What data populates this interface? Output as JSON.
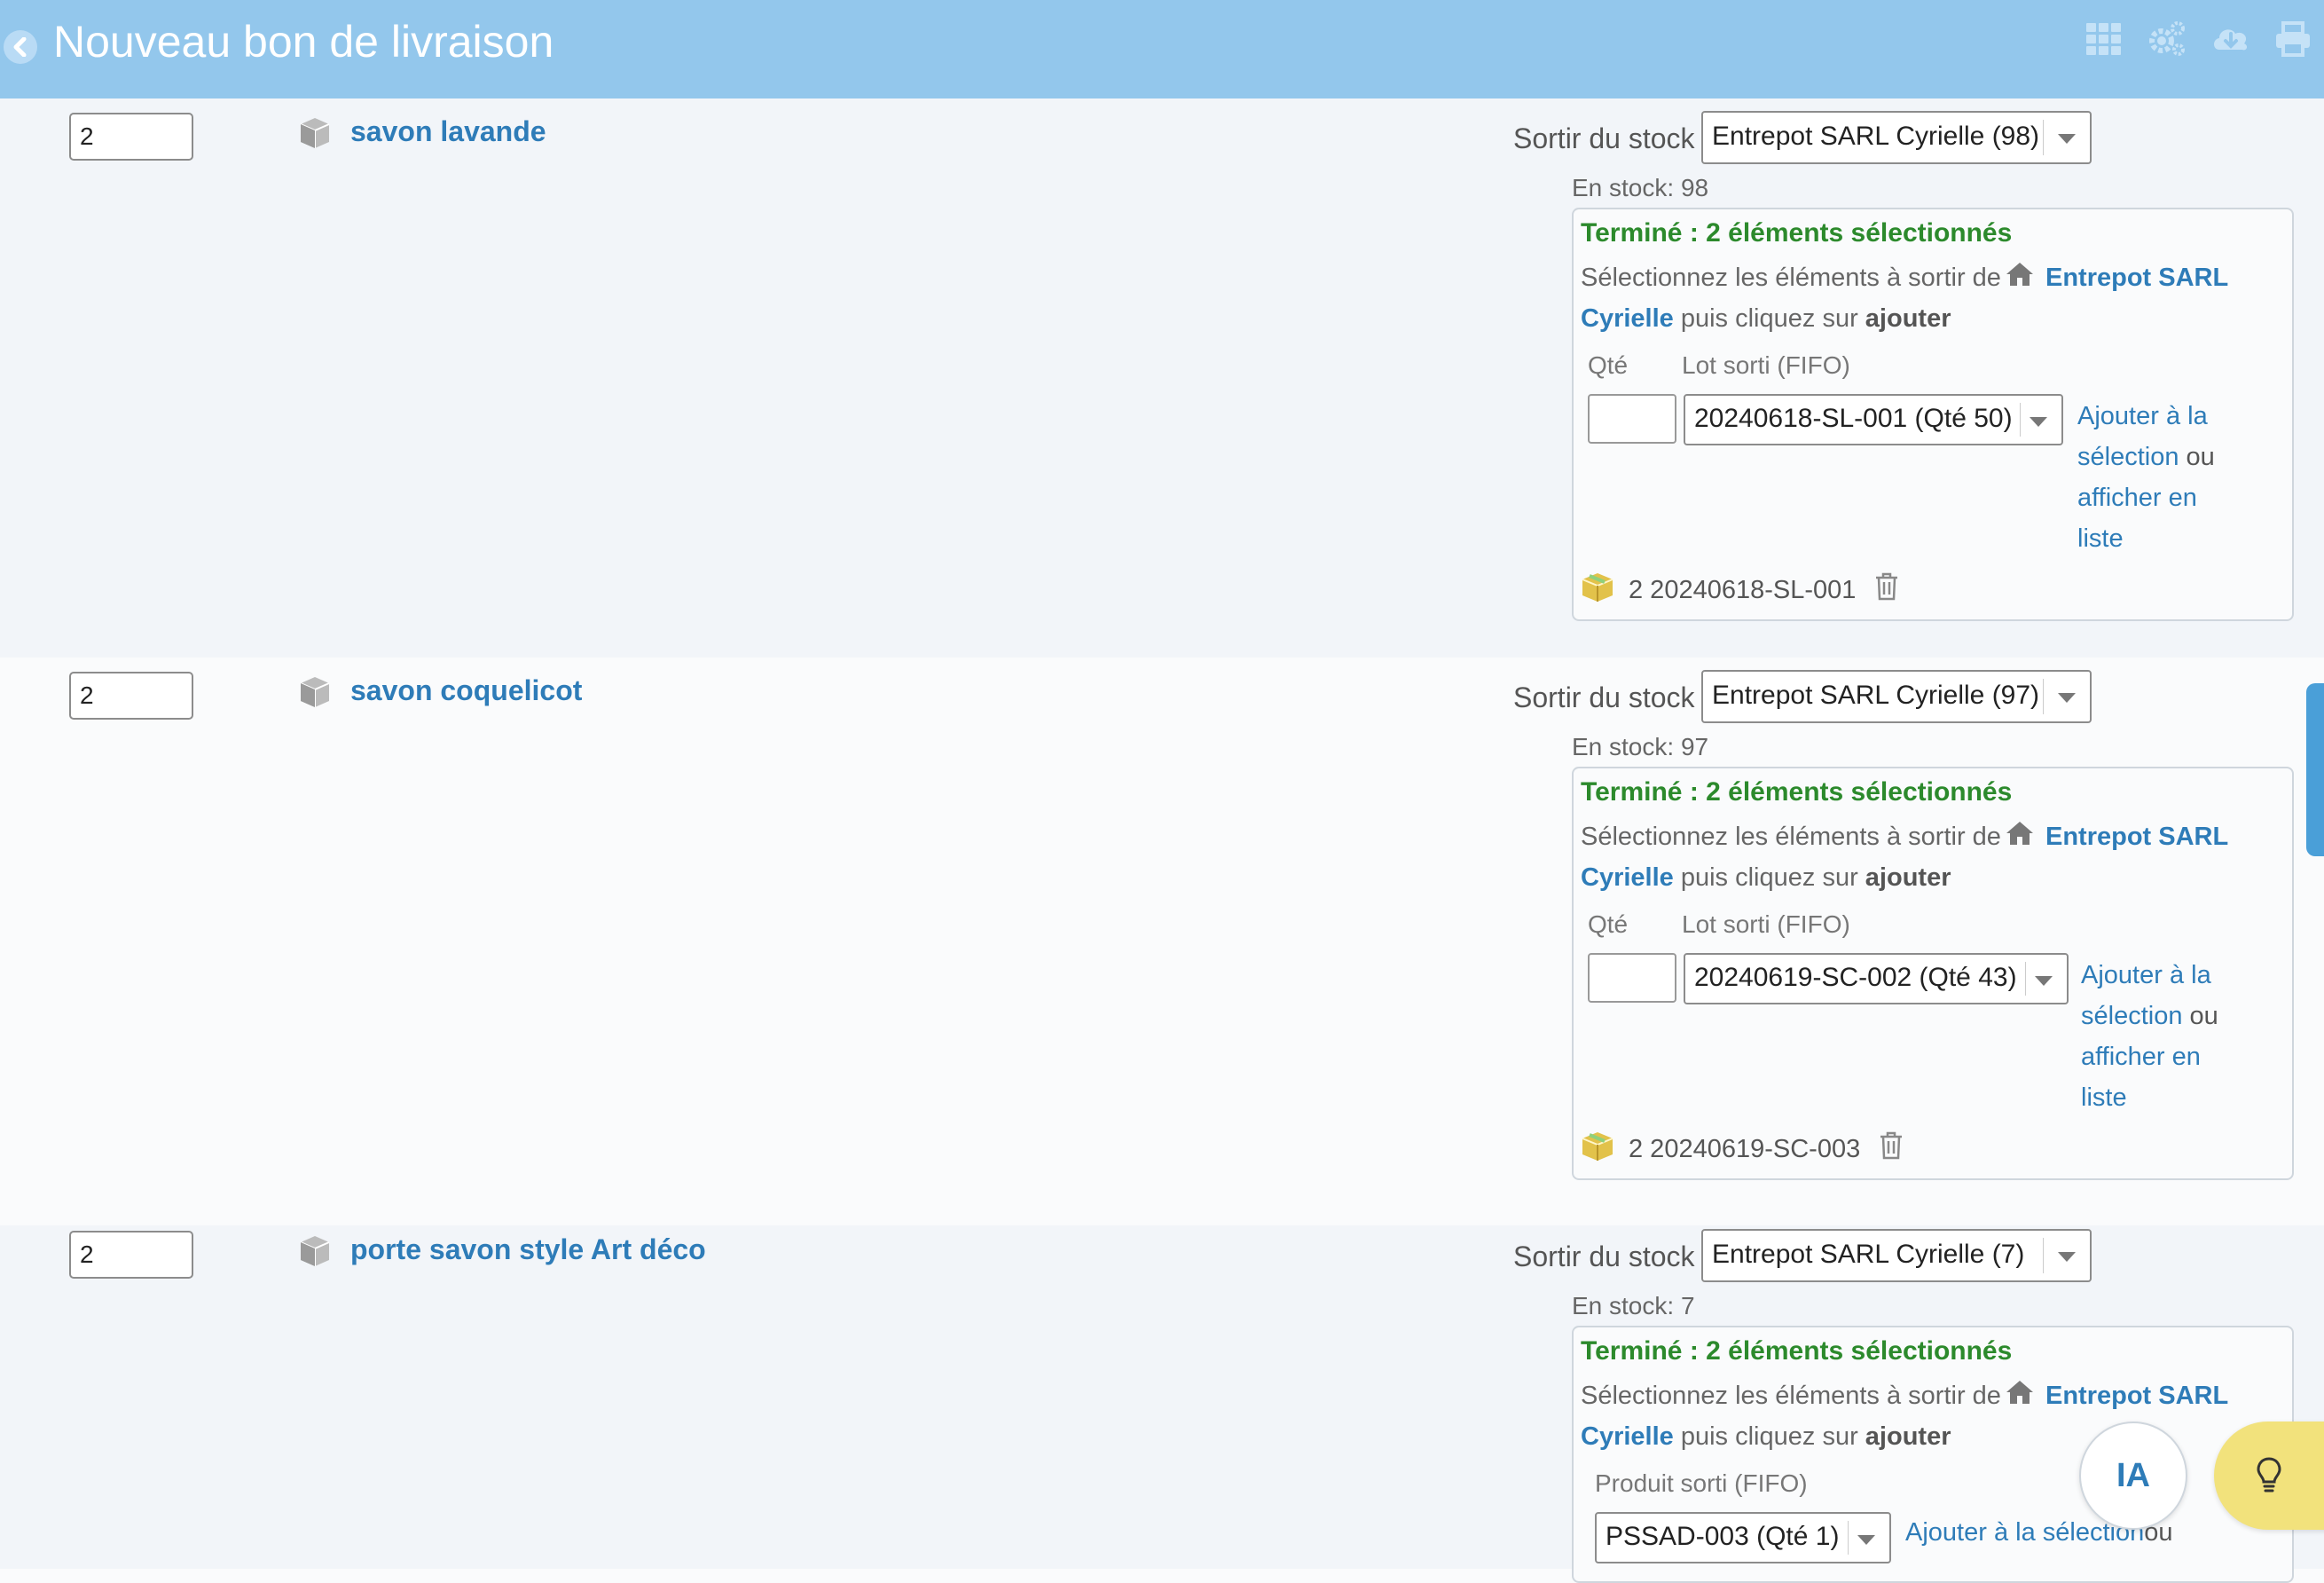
{
  "header": {
    "title": "Nouveau bon de livraison",
    "icons": [
      "back-icon",
      "grid-icon",
      "settings-icon",
      "cloud-download-icon",
      "print-icon"
    ]
  },
  "common": {
    "stock_label": "Sortir du stock",
    "instr_prefix": "Sélectionnez les éléments à sortir de",
    "warehouse_1": "Entrepot SARL",
    "warehouse_2": "Cyrielle",
    "instr_middle": "puis cliquez sur",
    "instr_action": "ajouter",
    "qte_label": "Qté",
    "add_1": "Ajouter à la",
    "add_2": "sélection",
    "add_or": "ou",
    "add_3": "afficher en",
    "add_4": "liste"
  },
  "lines": [
    {
      "quantity": "2",
      "product": "savon lavande",
      "warehouse_select": "Entrepot SARL Cyrielle (98)",
      "in_stock": "En stock: 98",
      "status": "Terminé : 2 éléments sélectionnés",
      "lot_label": "Lot sorti (FIFO)",
      "lot_select": "20240618-SL-001 (Qté 50)",
      "selected_lot": "2 20240618-SL-001"
    },
    {
      "quantity": "2",
      "product": "savon coquelicot",
      "warehouse_select": "Entrepot SARL Cyrielle (97)",
      "in_stock": "En stock: 97",
      "status": "Terminé : 2 éléments sélectionnés",
      "lot_label": "Lot sorti (FIFO)",
      "lot_select": "20240619-SC-002 (Qté 43)",
      "selected_lot": "2 20240619-SC-003"
    },
    {
      "quantity": "2",
      "product": "porte savon style Art déco",
      "warehouse_select": "Entrepot SARL Cyrielle (7)",
      "in_stock": "En stock: 7",
      "status": "Terminé : 2 éléments sélectionnés",
      "lot_label": "Produit sorti (FIFO)",
      "lot_select": "PSSAD-003 (Qté 1)",
      "add_inline": "Ajouter à la sélection",
      "add_inline_or": "ou"
    }
  ],
  "floating": {
    "ia_label": "IA",
    "tip_icon": "lightbulb-icon"
  },
  "colors": {
    "header_bg": "#93c7ec",
    "link": "#2e7cb8",
    "success": "#2c8a2c",
    "tip_bg": "#f2e27c"
  }
}
